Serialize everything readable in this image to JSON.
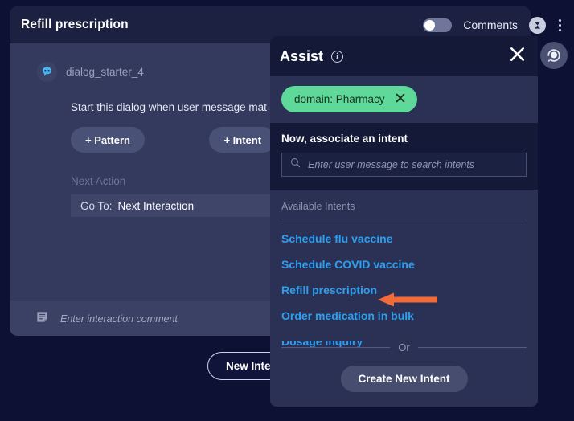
{
  "dialog_card": {
    "title": "Refill prescription",
    "starter": {
      "icon": "chat-bubble-icon",
      "name": "dialog_starter_4"
    },
    "description": "Start this dialog when user message mat",
    "buttons": {
      "pattern": "+ Pattern",
      "intent": "+ Intent"
    },
    "next_action": {
      "label": "Next Action",
      "goto_label": "Go To:",
      "goto_value": "Next Interaction"
    },
    "comment": {
      "icon": "note-icon",
      "placeholder": "Enter interaction comment"
    }
  },
  "top_controls": {
    "toggle_state": "off",
    "comments_label": "Comments",
    "close_icon": "circle-close-icon",
    "menu_icon": "kebab-menu-icon"
  },
  "new_interaction_button": "New Interaction",
  "assist": {
    "title": "Assist",
    "info_icon": "info-icon",
    "info_glyph": "i",
    "close_icon": "close-icon",
    "chip": {
      "label": "domain: Pharmacy",
      "remove_icon": "chip-remove-icon",
      "color": "#5fd99a"
    },
    "search": {
      "heading": "Now, associate an intent",
      "icon": "search-icon",
      "placeholder": "Enter user message to search intents",
      "value": ""
    },
    "intents": {
      "label": "Available Intents",
      "items": [
        "Schedule flu vaccine",
        "Schedule COVID vaccine",
        "Refill prescription",
        "Order medication in bulk",
        "Dosage inquiry"
      ],
      "link_color": "#2e9ff0"
    },
    "or_text": "Or",
    "create_button": "Create New Intent"
  },
  "annotation": {
    "arrow_icon": "left-arrow-annotation",
    "color": "#f26a35",
    "points_to": "Refill prescription"
  },
  "support_bubble": {
    "icon": "support-agent-icon"
  }
}
